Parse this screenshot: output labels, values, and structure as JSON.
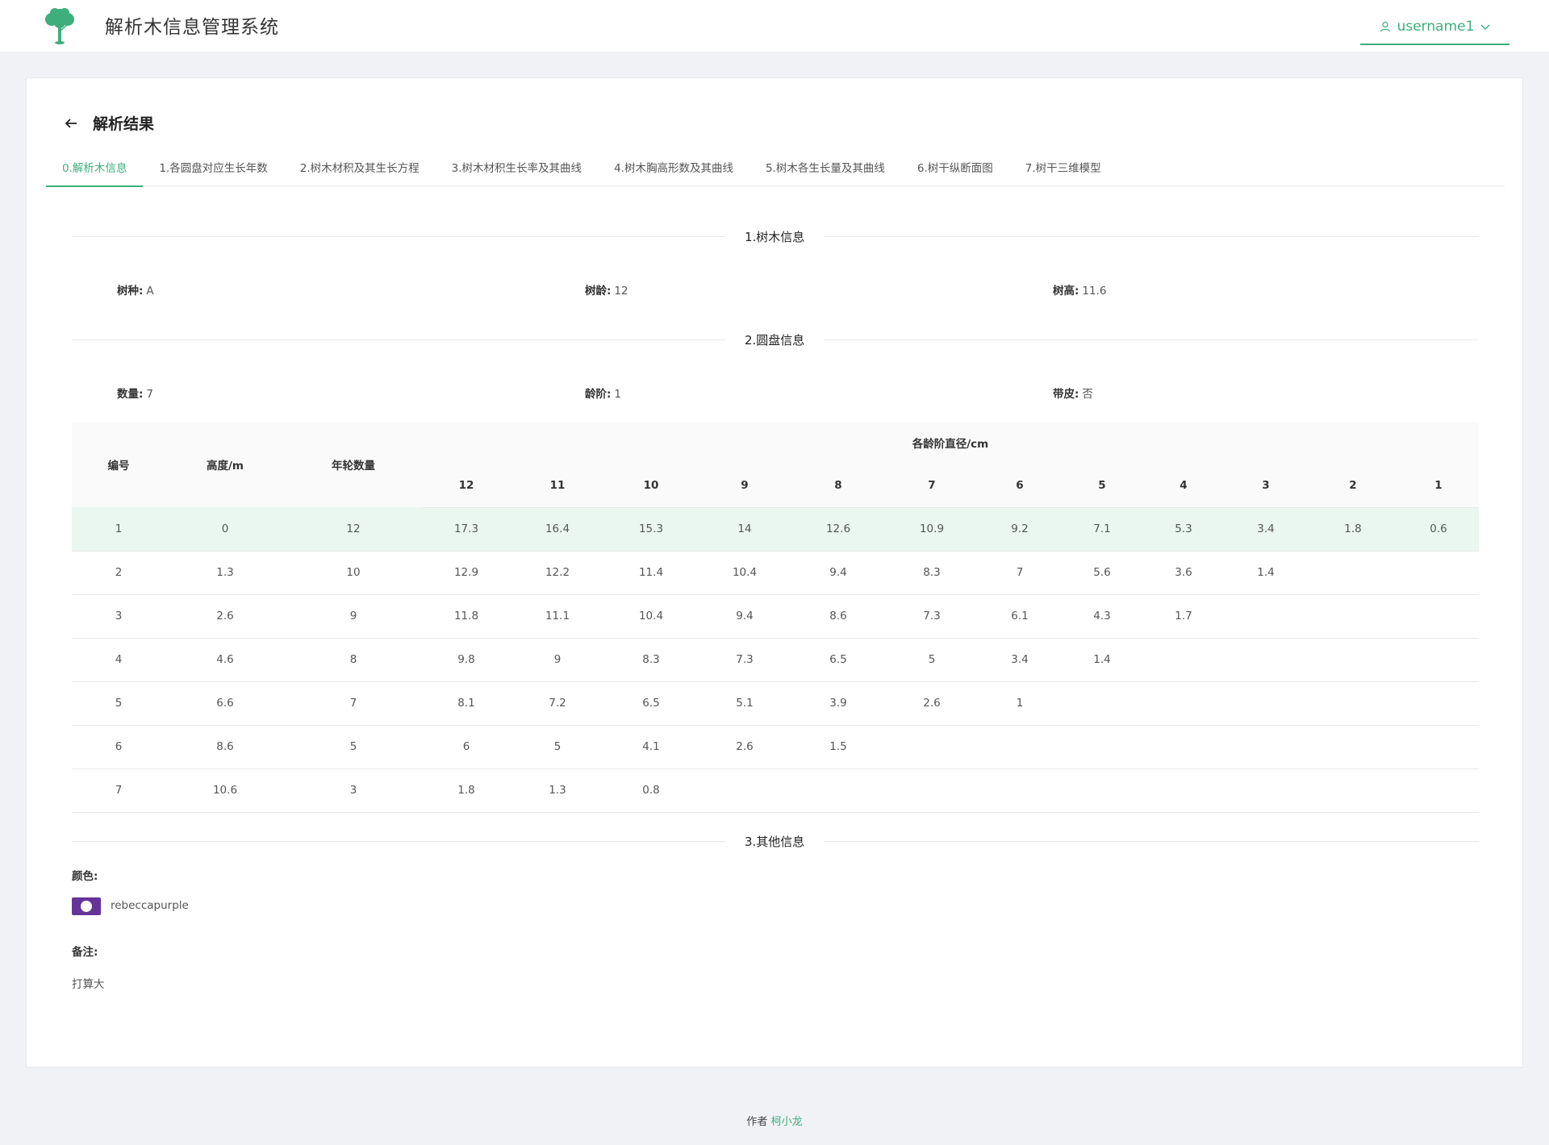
{
  "header": {
    "app_title": "解析木信息管理系统",
    "username": "username1",
    "accent_color": "#3eae7c"
  },
  "page": {
    "title": "解析结果"
  },
  "tabs": [
    {
      "label": "0.解析木信息",
      "active": true
    },
    {
      "label": "1.各圆盘对应生长年数"
    },
    {
      "label": "2.树木材积及其生长方程"
    },
    {
      "label": "3.树木材积生长率及其曲线"
    },
    {
      "label": "4.树木胸高形数及其曲线"
    },
    {
      "label": "5.树木各生长量及其曲线"
    },
    {
      "label": "6.树干纵断面图"
    },
    {
      "label": "7.树干三维模型"
    }
  ],
  "tree_info": {
    "section_title": "1.树木信息",
    "species_label": "树种:",
    "species_value": "A",
    "age_label": "树龄:",
    "age_value": "12",
    "height_label": "树高:",
    "height_value": "11.6"
  },
  "disc_info": {
    "section_title": "2.圆盘信息",
    "count_label": "数量:",
    "count_value": "7",
    "age_class_label": "龄阶:",
    "age_class_value": "1",
    "bark_label": "带皮:",
    "bark_value": "否"
  },
  "table": {
    "headers": {
      "id": "编号",
      "height": "高度/m",
      "rings": "年轮数量",
      "diameter_group": "各龄阶直径/cm"
    },
    "age_columns": [
      "12",
      "11",
      "10",
      "9",
      "8",
      "7",
      "6",
      "5",
      "4",
      "3",
      "2",
      "1"
    ],
    "rows": [
      {
        "id": "1",
        "height": "0",
        "rings": "12",
        "d": [
          "17.3",
          "16.4",
          "15.3",
          "14",
          "12.6",
          "10.9",
          "9.2",
          "7.1",
          "5.3",
          "3.4",
          "1.8",
          "0.6"
        ],
        "selected": true
      },
      {
        "id": "2",
        "height": "1.3",
        "rings": "10",
        "d": [
          "12.9",
          "12.2",
          "11.4",
          "10.4",
          "9.4",
          "8.3",
          "7",
          "5.6",
          "3.6",
          "1.4",
          "",
          ""
        ]
      },
      {
        "id": "3",
        "height": "2.6",
        "rings": "9",
        "d": [
          "11.8",
          "11.1",
          "10.4",
          "9.4",
          "8.6",
          "7.3",
          "6.1",
          "4.3",
          "1.7",
          "",
          "",
          ""
        ]
      },
      {
        "id": "4",
        "height": "4.6",
        "rings": "8",
        "d": [
          "9.8",
          "9",
          "8.3",
          "7.3",
          "6.5",
          "5",
          "3.4",
          "1.4",
          "",
          "",
          "",
          ""
        ]
      },
      {
        "id": "5",
        "height": "6.6",
        "rings": "7",
        "d": [
          "8.1",
          "7.2",
          "6.5",
          "5.1",
          "3.9",
          "2.6",
          "1",
          "",
          "",
          "",
          "",
          ""
        ]
      },
      {
        "id": "6",
        "height": "8.6",
        "rings": "5",
        "d": [
          "6",
          "5",
          "4.1",
          "2.6",
          "1.5",
          "",
          "",
          "",
          "",
          "",
          "",
          ""
        ]
      },
      {
        "id": "7",
        "height": "10.6",
        "rings": "3",
        "d": [
          "1.8",
          "1.3",
          "0.8",
          "",
          "",
          "",
          "",
          "",
          "",
          "",
          "",
          ""
        ]
      }
    ]
  },
  "other_info": {
    "section_title": "3.其他信息",
    "color_label": "颜色:",
    "color_value": "rebeccapurple",
    "color_hex": "#663399",
    "remark_label": "备注:",
    "remark_value": "打算大"
  },
  "footer": {
    "prefix": "作者",
    "author": "柯小龙"
  }
}
